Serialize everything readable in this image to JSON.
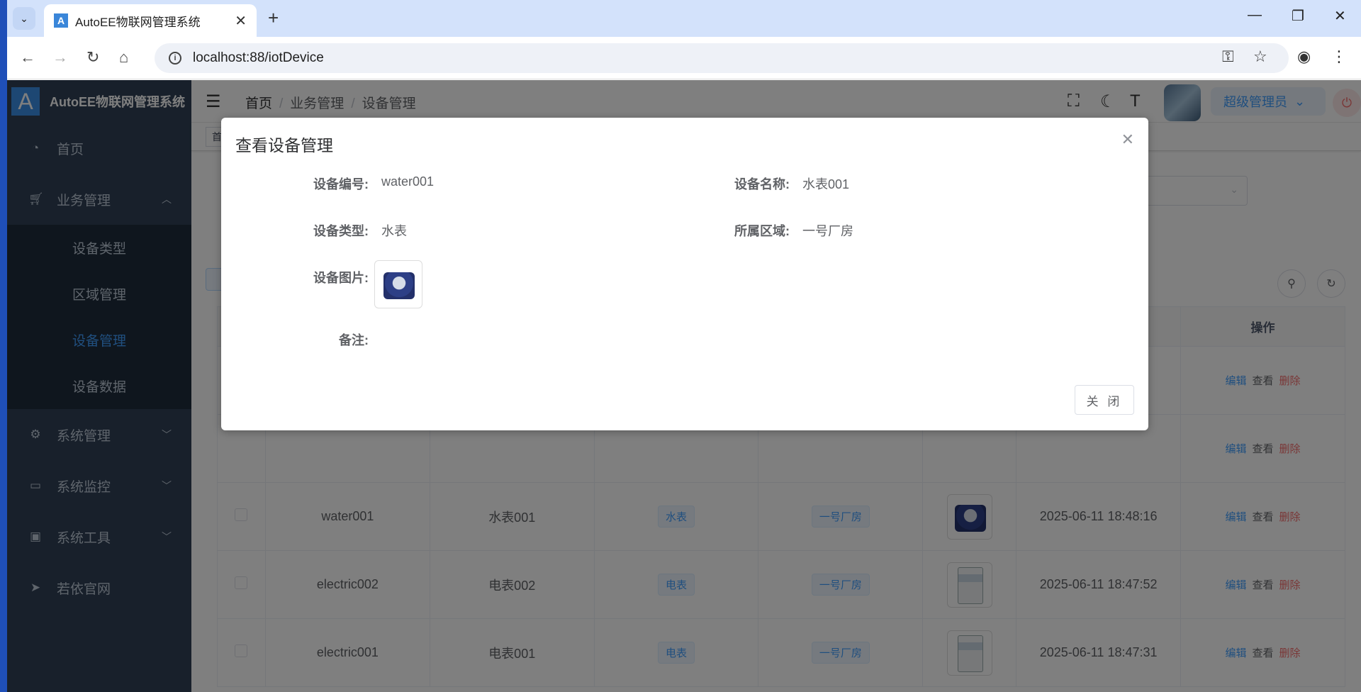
{
  "browser": {
    "tab_title": "AutoEE物联网管理系统",
    "tab_favicon": "A",
    "url": "localhost:88/iotDevice"
  },
  "sidebar": {
    "logo_letter": "A",
    "title": "AutoEE物联网管理系统",
    "items": [
      {
        "label": "首页",
        "icon": "dashboard-icon"
      },
      {
        "label": "业务管理",
        "icon": "cart-icon",
        "expanded": true
      },
      {
        "label": "系统管理",
        "icon": "gear-icon"
      },
      {
        "label": "系统监控",
        "icon": "monitor-icon"
      },
      {
        "label": "系统工具",
        "icon": "toolbox-icon"
      },
      {
        "label": "若依官网",
        "icon": "send-icon"
      }
    ],
    "sub_items": [
      {
        "label": "设备类型"
      },
      {
        "label": "区域管理"
      },
      {
        "label": "设备管理",
        "active": true
      },
      {
        "label": "设备数据"
      }
    ]
  },
  "navbar": {
    "breadcrumb": [
      "首页",
      "业务管理",
      "设备管理"
    ],
    "user": "超级管理员"
  },
  "tags_view": {
    "first_tag": "首"
  },
  "table": {
    "header_ops": "操作",
    "rows": [
      {
        "code": "water001",
        "name": "水表001",
        "type": "水表",
        "area": "一号厂房",
        "image": "water",
        "time": "2025-06-11 18:48:16"
      },
      {
        "code": "electric002",
        "name": "电表002",
        "type": "电表",
        "area": "一号厂房",
        "image": "electric",
        "time": "2025-06-11 18:47:52"
      },
      {
        "code": "electric001",
        "name": "电表001",
        "type": "电表",
        "area": "一号厂房",
        "image": "electric",
        "time": "2025-06-11 18:47:31"
      }
    ],
    "ops": {
      "edit": "编辑",
      "view": "查看",
      "delete": "删除"
    }
  },
  "dialog": {
    "title": "查看设备管理",
    "fields": {
      "code_label": "设备编号:",
      "code_value": "water001",
      "name_label": "设备名称:",
      "name_value": "水表001",
      "type_label": "设备类型:",
      "type_value": "水表",
      "area_label": "所属区域:",
      "area_value": "一号厂房",
      "image_label": "设备图片:",
      "remark_label": "备注:"
    },
    "close_button": "关 闭"
  },
  "colors": {
    "sidebar_bg": "#304156",
    "submenu_bg": "#1f2d3d",
    "accent": "#409eff",
    "danger": "#f56c6c"
  }
}
